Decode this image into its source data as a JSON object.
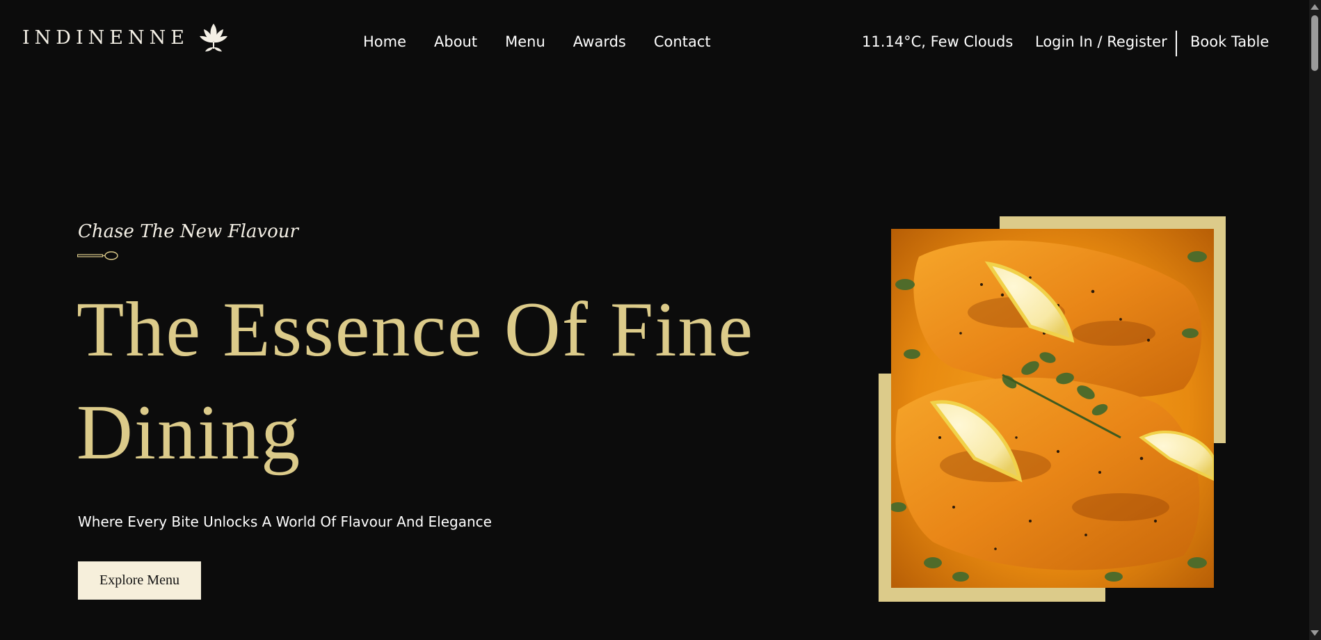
{
  "header": {
    "logo_text": "INDINENNE",
    "nav": [
      {
        "label": "Home"
      },
      {
        "label": "About"
      },
      {
        "label": "Menu"
      },
      {
        "label": "Awards"
      },
      {
        "label": "Contact"
      }
    ],
    "weather": "11.14°C, Few Clouds",
    "login_label": "Login In / Register",
    "book_label": "Book Table"
  },
  "hero": {
    "tagline": "Chase The New Flavour",
    "headline": "The Essence Of Fine Dining",
    "subtitle": "Where Every Bite Unlocks A World Of Flavour And Elegance",
    "cta_label": "Explore Menu"
  },
  "colors": {
    "background": "#0c0c0c",
    "accent_gold": "#dccb8a",
    "button_cream": "#f6efdb",
    "text_light": "#ffffff"
  },
  "icons": {
    "logo": "lotus-icon",
    "divider": "spoon-icon"
  }
}
